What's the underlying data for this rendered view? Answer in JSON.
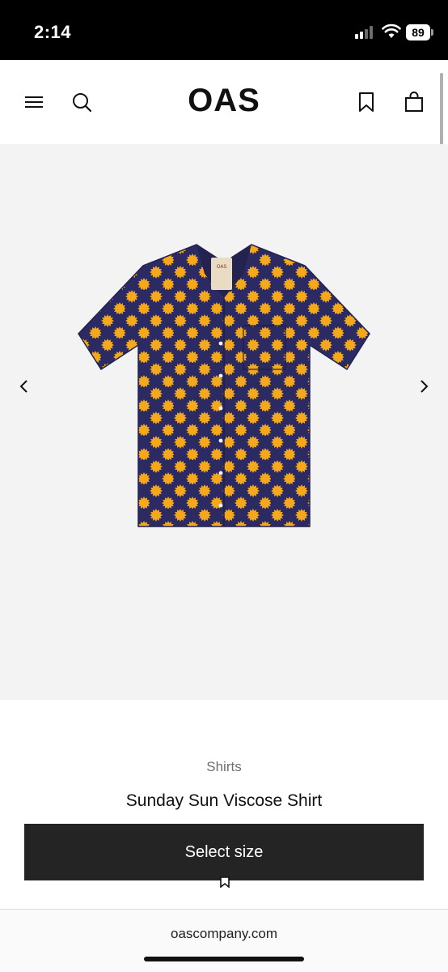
{
  "status_bar": {
    "time": "2:14",
    "battery": "89"
  },
  "header": {
    "logo": "OAS",
    "icons": [
      "menu-icon",
      "search-icon",
      "bookmark-icon",
      "bag-icon"
    ]
  },
  "product": {
    "category": "Shirts",
    "title": "Sunday Sun Viscose Shirt",
    "select_size_label": "Select size",
    "image_icon": "shirt-image",
    "colors": {
      "shirt": "#2c2a63",
      "sun": "#f4a91c"
    }
  },
  "browser": {
    "url": "oascompany.com"
  },
  "colors": {
    "button": "#242424",
    "gallery_bg": "#f3f3f3"
  }
}
